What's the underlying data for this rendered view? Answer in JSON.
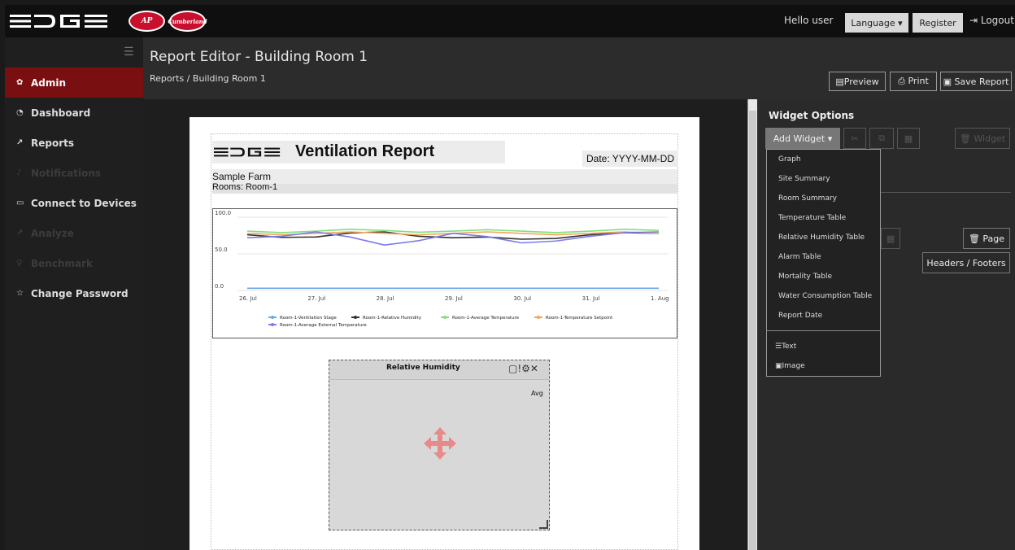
{
  "topbar": {
    "badge1": "AP",
    "badge2": "Cumberland",
    "hello": "Hello user",
    "language": "Language ▾",
    "register": "Register",
    "logout": "⇥ Logout"
  },
  "sidebar": {
    "items": [
      {
        "icon": "✿",
        "label": "Admin"
      },
      {
        "icon": "◔",
        "label": "Dashboard"
      },
      {
        "icon": "↗",
        "label": "Reports"
      },
      {
        "icon": "♪",
        "label": "Notifications"
      },
      {
        "icon": "▭",
        "label": "Connect to Devices"
      },
      {
        "icon": "↗",
        "label": "Analyze"
      },
      {
        "icon": "♀",
        "label": "Benchmark"
      },
      {
        "icon": "☆",
        "label": "Change Password"
      }
    ]
  },
  "header": {
    "title": "Report Editor - Building Room 1",
    "breadcrumb": "Reports  /  Building Room 1"
  },
  "toolbar": {
    "preview": "▤Preview",
    "print": "⎙ Print",
    "save": "▣ Save Report"
  },
  "report": {
    "title": "Ventilation Report",
    "date": "Date: YYYY-MM-DD",
    "farm": "Sample Farm",
    "rooms": "Rooms: Room-1"
  },
  "humidity_widget": {
    "title": "Relative Humidity",
    "tools": "▢!⚙✕",
    "avg": "Avg"
  },
  "options": {
    "title": "Widget Options",
    "add_widget": "Add Widget ▾",
    "ghost_widget": "🗑 Widget",
    "page": "🗑 Page",
    "headers_footers": "Headers / Footers",
    "menu": [
      "Graph",
      "Site Summary",
      "Room Summary",
      "Temperature Table",
      "Relative Humidity Table",
      "Alarm Table",
      "Mortality Table",
      "Water Consumption Table",
      "Report Date"
    ],
    "menu_text": "☰Text",
    "menu_image": "▣Image"
  },
  "chart_data": {
    "type": "line",
    "title": "",
    "ylim": [
      0,
      100
    ],
    "yticks": [
      "100.0",
      "50.0",
      "0.0"
    ],
    "categories": [
      "26. Jul",
      "27. Jul",
      "28. Jul",
      "29. Jul",
      "30. Jul",
      "31. Jul",
      "1. Aug"
    ],
    "series": [
      {
        "name": "Room-1-Ventilation Stage",
        "color": "#6aa6e8",
        "values": [
          3,
          3,
          3,
          3,
          3,
          3,
          3
        ]
      },
      {
        "name": "Room-1-Relative Humidity",
        "color": "#333333",
        "values": [
          76,
          73,
          80,
          72,
          70,
          76,
          78
        ]
      },
      {
        "name": "Room-1-Average Temperature",
        "color": "#7ee07e",
        "values": [
          81,
          81,
          82,
          81,
          81,
          81,
          82
        ]
      },
      {
        "name": "Room-1-Temperature Setpoint",
        "color": "#f5a55a",
        "values": [
          78,
          78,
          78,
          78,
          78,
          78,
          78
        ]
      },
      {
        "name": "Room-1-Average External Temperature",
        "color": "#7b7bea",
        "values": [
          72,
          80,
          62,
          78,
          65,
          74,
          80
        ]
      }
    ]
  }
}
